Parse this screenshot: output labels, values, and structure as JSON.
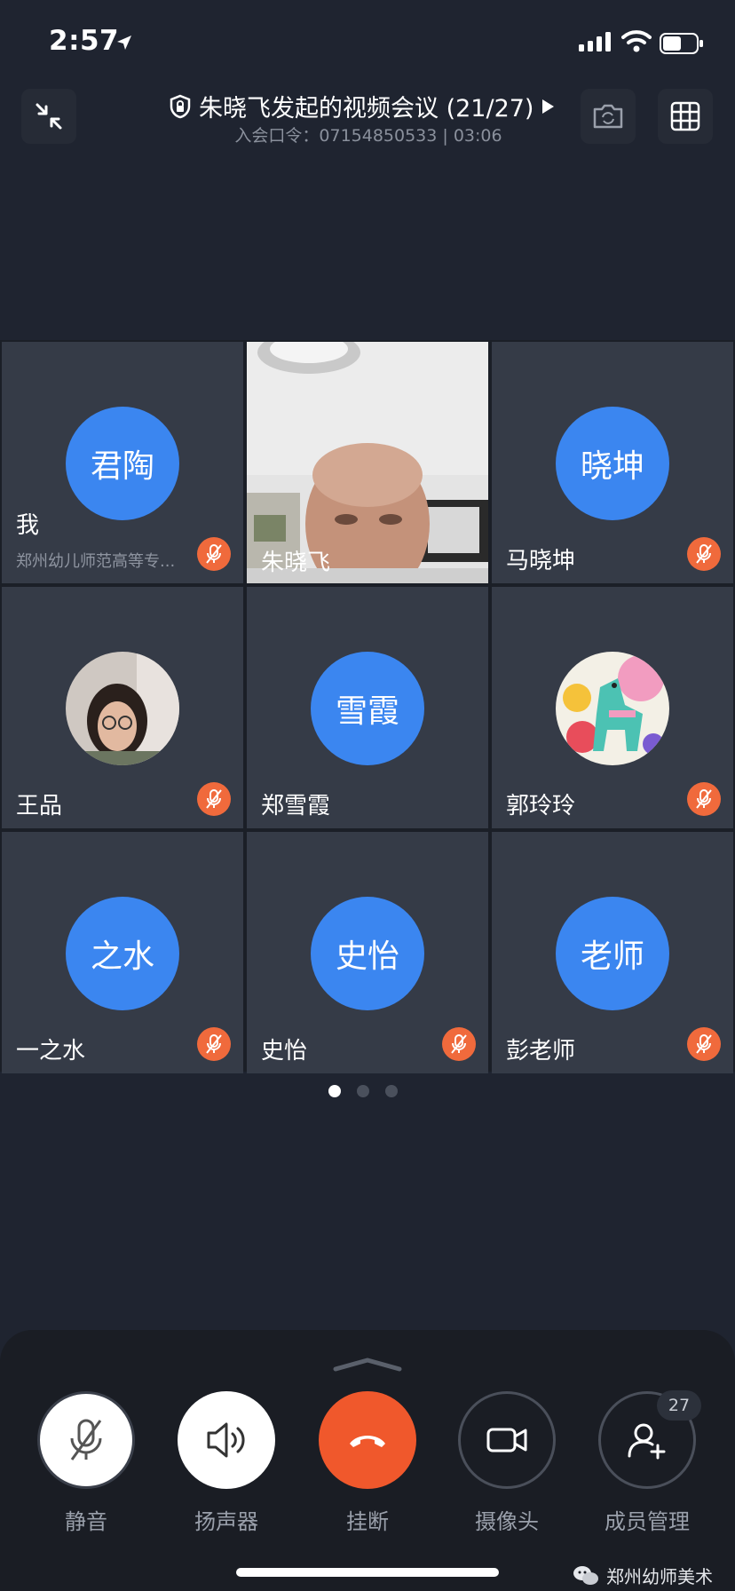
{
  "status_bar": {
    "time": "2:57"
  },
  "header": {
    "title": "朱晓飞发起的视频会议 (21/27)",
    "subtitle": "入会口令：07154850533 | 03:06"
  },
  "tiles": [
    {
      "name": "我",
      "avatar_text": "君陶",
      "sub": "郑州幼儿师范高等专..."
    },
    {
      "name": "朱晓飞"
    },
    {
      "name": "马晓坤",
      "avatar_text": "晓坤"
    },
    {
      "name": "王品"
    },
    {
      "name": "郑雪霞",
      "avatar_text": "雪霞"
    },
    {
      "name": "郭玲玲"
    },
    {
      "name": "一之水",
      "avatar_text": "之水"
    },
    {
      "name": "史怡",
      "avatar_text": "史怡"
    },
    {
      "name": "彭老师",
      "avatar_text": "老师"
    }
  ],
  "pagination": {
    "pages": 3,
    "current": 1
  },
  "controls": {
    "mute": "静音",
    "speaker": "扬声器",
    "hangup": "挂断",
    "camera": "摄像头",
    "members": "成员管理",
    "member_count": "27"
  },
  "watermark": "郑州幼师美术",
  "colors": {
    "background": "#1f2430",
    "tile": "#353b47",
    "avatar": "#3b86f0",
    "mute_badge": "#f06a3c",
    "hangup": "#f0582c"
  }
}
